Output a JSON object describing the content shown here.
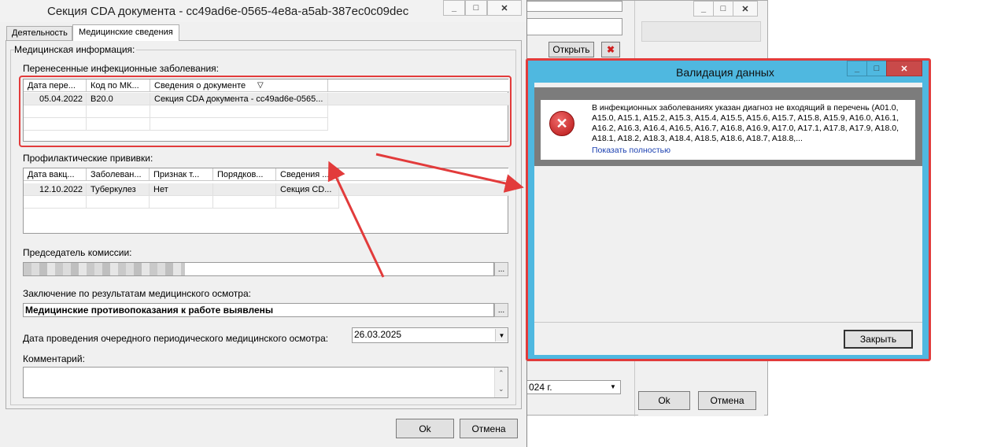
{
  "main_window": {
    "title": "Секция CDA документа - cc49ad6e-0565-4e8a-a5ab-387ec0c09dec",
    "tabs": [
      {
        "label": "Деятельность"
      },
      {
        "label": "Медицинские сведения"
      }
    ],
    "group_title": "Медицинская информация:",
    "infections": {
      "label": "Перенесенные инфекционные заболевания:",
      "columns": [
        "Дата перe...",
        "Код по МК...",
        "Сведения о документе"
      ],
      "rows": [
        [
          "05.04.2022",
          "B20.0",
          "Секция CDA документа - cc49ad6e-0565..."
        ]
      ]
    },
    "vaccines": {
      "label": "Профилактические прививки:",
      "columns": [
        "Дата вакц...",
        "Заболеван...",
        "Признак т...",
        "Порядков...",
        "Сведения ..."
      ],
      "rows": [
        [
          "12.10.2022",
          "Туберкулез",
          "Нет",
          "",
          "Секция CD..."
        ]
      ]
    },
    "chairman": {
      "label": "Председатель комиссии:",
      "value": "",
      "ellipsis": "..."
    },
    "conclusion": {
      "label": "Заключение по результатам медицинского осмотра:",
      "value": "Медицинские противопоказания к работе выявлены",
      "ellipsis": "..."
    },
    "next_date": {
      "label": "Дата проведения очередного периодического медицинского осмотра:",
      "value": "26.03.2025"
    },
    "comment": {
      "label": "Комментарий:",
      "value": ""
    },
    "ok_label": "Ok",
    "cancel_label": "Отмена"
  },
  "background_window": {
    "open_label": "Открыть",
    "date_fragment": "024 г.",
    "ok_label": "Ok",
    "cancel_label": "Отмена"
  },
  "dialog": {
    "title": "Валидация данных",
    "message": "В инфекционных заболеваниях указан диагноз не входящий в перечень (A01.0, A15.0, A15.1, A15.2, A15.3, A15.4, A15.5, A15.6, A15.7, A15.8, A15.9, A16.0, A16.1, A16.2, A16.3, A16.4, A16.5, A16.7, A16.8, A16.9, A17.0, A17.1, A17.8, A17.9, A18.0, A18.1, A18.2, A18.3, A18.4, A18.5, A18.6, A18.7, A18.8,...",
    "show_full_link": "Показать полностью",
    "close_label": "Закрыть"
  },
  "colors": {
    "annotation": "#e23b3b",
    "dialog_frame": "#4fb8e0",
    "close_hover": "#c94a4a"
  },
  "icons": [
    "minimize-icon",
    "maximize-icon",
    "close-icon",
    "error-icon",
    "dropdown-arrow-icon",
    "sort-arrow-icon",
    "scroll-up-icon",
    "scroll-down-icon",
    "delete-icon"
  ]
}
